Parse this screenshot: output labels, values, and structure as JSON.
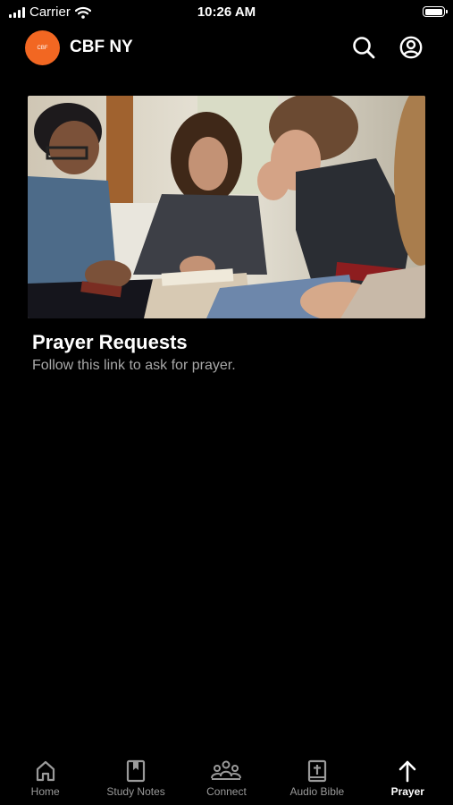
{
  "status_bar": {
    "carrier": "Carrier",
    "time": "10:26 AM"
  },
  "header": {
    "logo_text": "CBF",
    "title": "CBF NY",
    "icons": [
      "search-icon",
      "profile-icon"
    ]
  },
  "card": {
    "image": "photo: group of young people praying with bibles",
    "title": "Prayer Requests",
    "subtitle": "Follow this link to ask for prayer."
  },
  "tabs": [
    {
      "label": "Home",
      "icon": "home-icon",
      "active": false
    },
    {
      "label": "Study Notes",
      "icon": "bookmark-icon",
      "active": false
    },
    {
      "label": "Connect",
      "icon": "people-icon",
      "active": false
    },
    {
      "label": "Audio Bible",
      "icon": "bible-icon",
      "active": false
    },
    {
      "label": "Prayer",
      "icon": "arrow-up-icon",
      "active": true
    }
  ],
  "colors": {
    "brand": "#f26722",
    "background": "#000000",
    "inactive_tab": "#9a9a9a"
  }
}
